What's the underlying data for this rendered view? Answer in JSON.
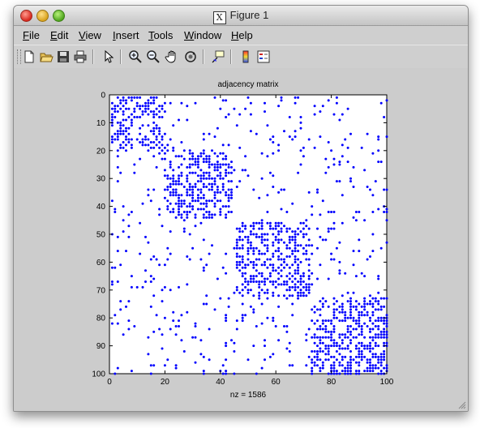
{
  "window": {
    "title": "Figure 1"
  },
  "menubar": {
    "items": [
      {
        "label": "File",
        "underline": "F",
        "rest": "ile"
      },
      {
        "label": "Edit",
        "underline": "E",
        "rest": "dit"
      },
      {
        "label": "View",
        "underline": "V",
        "rest": "iew"
      },
      {
        "label": "Insert",
        "underline": "I",
        "rest": "nsert"
      },
      {
        "label": "Tools",
        "underline": "T",
        "rest": "ools"
      },
      {
        "label": "Window",
        "underline": "W",
        "rest": "indow"
      },
      {
        "label": "Help",
        "underline": "H",
        "rest": "elp"
      }
    ]
  },
  "toolbar": {
    "icons": [
      "new-figure-icon",
      "open-file-icon",
      "save-icon",
      "print-icon",
      "pointer-icon",
      "zoom-in-icon",
      "zoom-out-icon",
      "pan-hand-icon",
      "rotate-3d-icon",
      "data-cursor-icon",
      "colorbar-icon",
      "legend-icon"
    ]
  },
  "plot": {
    "title": "adjacency matrix",
    "xlabel": "nz = 1586"
  },
  "chart_data": {
    "type": "scatter",
    "title": "adjacency matrix",
    "xlabel": "nz = 1586",
    "ylabel": "",
    "xlim": [
      0,
      100
    ],
    "ylim": [
      100,
      0
    ],
    "y_axis_reversed": true,
    "xticks": [
      0,
      20,
      40,
      60,
      80,
      100
    ],
    "yticks": [
      0,
      10,
      20,
      30,
      40,
      50,
      60,
      70,
      80,
      90,
      100
    ],
    "marker_color": "#0000ff",
    "nonzero_count": 1586,
    "dense_blocks": [
      {
        "rows": [
          1,
          19
        ],
        "cols": [
          1,
          19
        ]
      },
      {
        "rows": [
          20,
          44
        ],
        "cols": [
          20,
          47
        ]
      },
      {
        "rows": [
          46,
          72
        ],
        "cols": [
          45,
          72
        ]
      },
      {
        "rows": [
          73,
          100
        ],
        "cols": [
          73,
          100
        ]
      }
    ],
    "density": {
      "in_block": 0.45,
      "off_block": 0.05
    }
  }
}
